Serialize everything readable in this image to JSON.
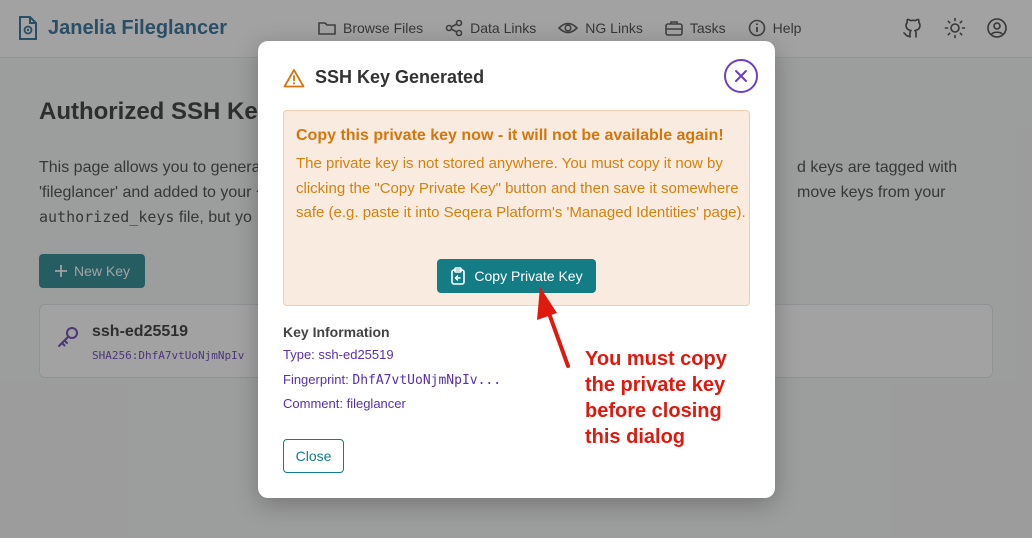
{
  "app": {
    "title": "Janelia Fileglancer",
    "brand_color": "#1c5f8e",
    "accent": "#137c84"
  },
  "nav": {
    "links": [
      {
        "label": "Browse Files",
        "icon": "folder-icon"
      },
      {
        "label": "Data Links",
        "icon": "share-icon"
      },
      {
        "label": "NG Links",
        "icon": "eye-icon"
      },
      {
        "label": "Tasks",
        "icon": "briefcase-icon"
      },
      {
        "label": "Help",
        "icon": "info-icon"
      }
    ],
    "right_icons": [
      "github-icon",
      "sun-icon",
      "user-icon"
    ]
  },
  "page": {
    "title": "Authorized SSH Ke",
    "desc_line1": "This page allows you to genera",
    "desc_line1_right": "d keys are tagged with",
    "desc_line2": "'fileglancer' and added to your ~",
    "desc_line2_right": "move keys from your",
    "desc_code": "authorized_keys",
    "desc_line3_tail": " file, but yo",
    "new_key_label": "New Key",
    "key_name": "ssh-ed25519",
    "key_fp": "SHA256:DhfA7vtUoNjmNpIv"
  },
  "dialog": {
    "title": "SSH Key Generated",
    "warn_title": "Copy this private key now - it will not be available again!",
    "warn_body": "The private key is not stored anywhere. You must copy it now by clicking the \"Copy Private Key\" button and then save it somewhere safe (e.g. paste it into Seqera Platform's 'Managed Identities' page).",
    "copy_label": "Copy Private Key",
    "info_title": "Key Information",
    "type_label": "Type: ",
    "type_value": "ssh-ed25519",
    "fp_label": "Fingerprint: ",
    "fp_value": "DhfA7vtUoNjmNpIv...",
    "comment_label": "Comment: ",
    "comment_value": "fileglancer",
    "close_label": "Close"
  },
  "annotation": {
    "lines": [
      "You must copy",
      "the private key",
      "before closing",
      "this dialog"
    ],
    "color": "#e0190e"
  }
}
